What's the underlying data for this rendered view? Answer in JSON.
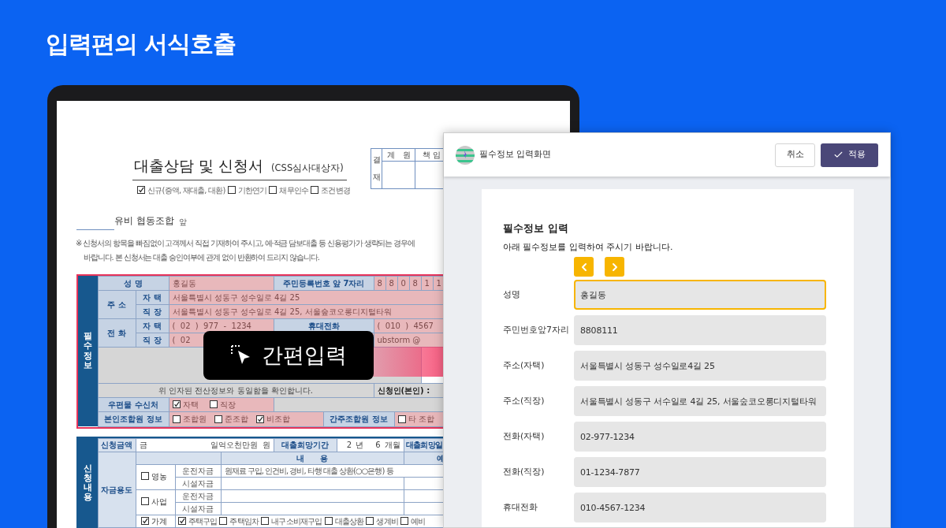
{
  "heading": "입력편의 서식호출",
  "document": {
    "title": "대출상담 및 신청서",
    "subtitle": "(CSS심사대상자)",
    "types": [
      {
        "label": "신규(증액, 재대출, 대환)",
        "checked": true
      },
      {
        "label": "기한연기",
        "checked": false
      },
      {
        "label": "채무인수",
        "checked": false
      },
      {
        "label": "조건변경",
        "checked": false
      }
    ],
    "approval": {
      "side": "결재",
      "columns": [
        "계　원",
        "책 임"
      ]
    },
    "addressee": "유비 협동조합",
    "addressee_suffix": "앞",
    "notice": [
      "※ 신청서의 항목을 빠짐없이 고객께서 직접 기재하여 주시고, 예·적금 담보대출 등 신용평가가 생략되는 경우에",
      "바랍니다. 본 신청서는 대출 승인여부에 관계 없이 반환하여 드리지 않습니다."
    ],
    "required": {
      "side": "필수정보",
      "name_label": "성 명",
      "name": "홍길동",
      "id_label": "주민등록번호 앞 7자리",
      "id_digits": [
        "8",
        "8",
        "0",
        "8",
        "1",
        "1"
      ],
      "address_label": "주 소",
      "address_rows": [
        {
          "label": "자 택",
          "value": "서울특별시 성동구 성수일로 4길 25"
        },
        {
          "label": "직 장",
          "value": "서울특별시 성동구 성수일로 4길 25, 서울숲코오롱디지털타워"
        }
      ],
      "phone_label": "전 화",
      "phone_rows": [
        {
          "label": "자 택",
          "value": "(  02  )  977  -  1234"
        },
        {
          "label": "직 장",
          "value": "(  02"
        }
      ],
      "mobile_label": "휴대전화",
      "mobile": "(  010  )  4567",
      "email": "ubstorm @",
      "confirm": "위 인자된 전산정보와 동일함을 확인합니다.",
      "applicant": "신청인(본인) :",
      "mail_label": "우편물 수신처",
      "mail_options": [
        {
          "label": "자택",
          "checked": true
        },
        {
          "label": "직장",
          "checked": false
        }
      ],
      "member_label": "본인조합원 정보",
      "member_options": [
        {
          "label": "조합원",
          "checked": false
        },
        {
          "label": "준조합",
          "checked": false
        },
        {
          "label": "비조합",
          "checked": true
        }
      ],
      "deemed_label": "간주조합원 정보",
      "deemed_options": [
        {
          "label": "타 조합",
          "checked": false
        }
      ]
    },
    "request": {
      "side": "신청내용",
      "amount_label": "신청금액",
      "amount_prefix": "금",
      "amount": "일억오천만원",
      "amount_unit": "원",
      "period_label": "대출희망기간",
      "years": "2",
      "years_unit": "년",
      "months": "6",
      "months_unit": "개월",
      "date_label": "대출희망일",
      "purpose_label": "자금용도",
      "content_header": "내　　용",
      "column_7": "예",
      "purposes": [
        {
          "kind": "rows",
          "label": "영농",
          "checked": false,
          "rows": [
            {
              "label": "운전자금",
              "content": "원재료 구입, 인건비, 경비, 타행 대출 상환(○○은행) 등"
            },
            {
              "label": "시설자금"
            }
          ]
        },
        {
          "kind": "rows",
          "label": "사업",
          "checked": false,
          "rows": [
            {
              "label": "운전자금"
            },
            {
              "label": "시설자금"
            }
          ]
        },
        {
          "kind": "options",
          "label": "가계",
          "checked": true,
          "options": [
            {
              "label": "주택구입",
              "checked": true
            },
            {
              "label": "주택임차",
              "checked": false
            },
            {
              "label": "내구소비재구입",
              "checked": false
            },
            {
              "label": "대출상환",
              "checked": false
            },
            {
              "label": "생계비",
              "checked": false
            },
            {
              "label": "예비",
              "checked": false
            }
          ]
        }
      ]
    }
  },
  "badge": "간편입력",
  "dialog": {
    "title": "필수정보 입력화면",
    "cancel": "취소",
    "apply": "적용",
    "heading": "필수정보 입력",
    "instruction": "아래 필수정보를 입력하여 주시기 바랍니다.",
    "fields": [
      {
        "label": "성명",
        "value": "홍길동",
        "selected": true
      },
      {
        "label": "주민번호앞7자리",
        "value": "8808111",
        "selected": false
      },
      {
        "label": "주소(자택)",
        "value": "서울특별시 성동구 성수일로4길 25",
        "selected": false
      },
      {
        "label": "주소(직장)",
        "value": "서울특별시 성동구 서수일로 4길 25, 서울숲코오롱디지털타워",
        "selected": false
      },
      {
        "label": "전화(자택)",
        "value": "02-977-1234",
        "selected": false
      },
      {
        "label": "전화(직장)",
        "value": "01-1234-7877",
        "selected": false
      },
      {
        "label": "휴대전화",
        "value": "010-4567-1234",
        "selected": false
      }
    ]
  }
}
